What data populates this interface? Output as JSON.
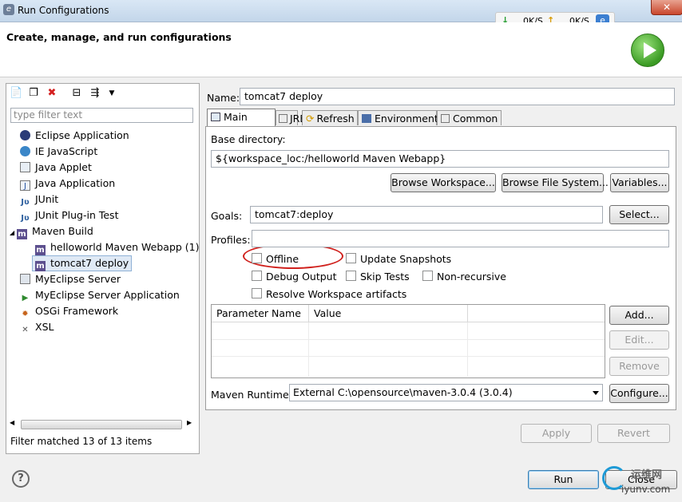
{
  "window": {
    "title": "Run Configurations",
    "close_label": "✕"
  },
  "speed": {
    "down": "0K/S",
    "up": "0K/S"
  },
  "header": {
    "subtitle": "Create, manage, and run configurations"
  },
  "left": {
    "filter_placeholder": "type filter text",
    "tree": [
      {
        "label": "Eclipse Application",
        "icon": "eclipse-app-icon"
      },
      {
        "label": "IE JavaScript",
        "icon": "ie-javascript-icon"
      },
      {
        "label": "Java Applet",
        "icon": "java-applet-icon"
      },
      {
        "label": "Java Application",
        "icon": "java-application-icon"
      },
      {
        "label": "JUnit",
        "icon": "junit-icon"
      },
      {
        "label": "JUnit Plug-in Test",
        "icon": "junit-plugin-icon"
      },
      {
        "label": "Maven Build",
        "icon": "maven-icon"
      },
      {
        "label": "helloworld Maven Webapp (1)",
        "icon": "maven-icon"
      },
      {
        "label": "tomcat7 deploy",
        "icon": "maven-icon"
      },
      {
        "label": "MyEclipse Server",
        "icon": "myeclipse-server-icon"
      },
      {
        "label": "MyEclipse Server Application",
        "icon": "myeclipse-app-icon"
      },
      {
        "label": "OSGi Framework",
        "icon": "osgi-icon"
      },
      {
        "label": "XSL",
        "icon": "xsl-icon"
      }
    ],
    "status": "Filter matched 13 of 13 items"
  },
  "right": {
    "name_label": "Name:",
    "name_value": "tomcat7 deploy",
    "tabs": [
      "Main",
      "JRE",
      "Refresh",
      "Environment",
      "Common"
    ],
    "base_dir_label": "Base directory:",
    "base_dir_value": "${workspace_loc:/helloworld Maven Webapp}",
    "browse_workspace": "Browse Workspace...",
    "browse_fs": "Browse File System...",
    "variables": "Variables...",
    "goals_label": "Goals:",
    "goals_value": "tomcat7:deploy",
    "select": "Select...",
    "profiles_label": "Profiles:",
    "profiles_value": "",
    "checkboxes": {
      "offline": "Offline",
      "update_snapshots": "Update Snapshots",
      "debug_output": "Debug Output",
      "skip_tests": "Skip Tests",
      "non_recursive": "Non-recursive",
      "resolve_workspace": "Resolve Workspace artifacts"
    },
    "table_headers": [
      "Parameter Name",
      "Value"
    ],
    "add": "Add...",
    "edit": "Edit...",
    "remove": "Remove",
    "runtime_label": "Maven Runtime:",
    "runtime_value": "External C:\\opensource\\maven-3.0.4 (3.0.4)",
    "configure": "Configure...",
    "apply": "Apply",
    "revert": "Revert"
  },
  "footer": {
    "run": "Run",
    "close": "Close",
    "watermark_top": "运维网",
    "watermark_bottom": "iyunv.com"
  }
}
